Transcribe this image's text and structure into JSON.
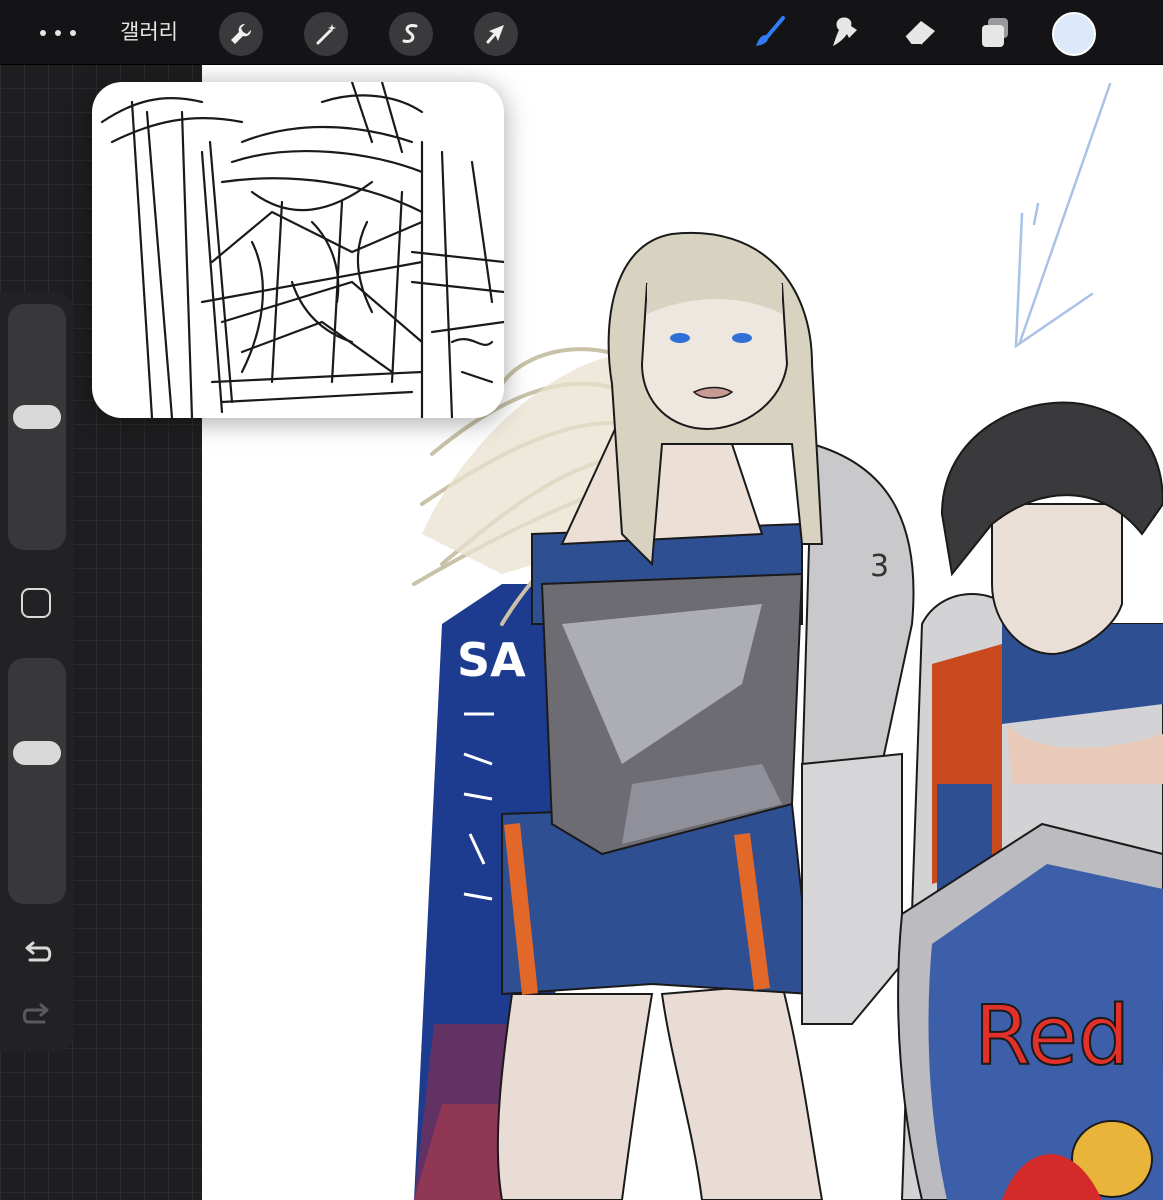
{
  "topbar": {
    "gallery_label": "갤러리",
    "tools_left": [
      "wrench-icon",
      "magic-wand-icon",
      "selection-icon",
      "transform-arrow-icon"
    ],
    "tools_right": [
      "brush-icon",
      "smudge-icon",
      "eraser-icon",
      "layers-icon"
    ],
    "active_tool": "brush-icon",
    "active_color": "#dce9fa",
    "accent": "#2f7cf6"
  },
  "sidebar": {
    "brush_size_level": 0.55,
    "opacity_level": 0.64,
    "items": [
      "brush-size-slider",
      "modifier-button",
      "opacity-slider",
      "undo-button",
      "redo-button"
    ]
  },
  "canvas": {
    "shield_text": "Red B",
    "cape_text": "SA"
  }
}
